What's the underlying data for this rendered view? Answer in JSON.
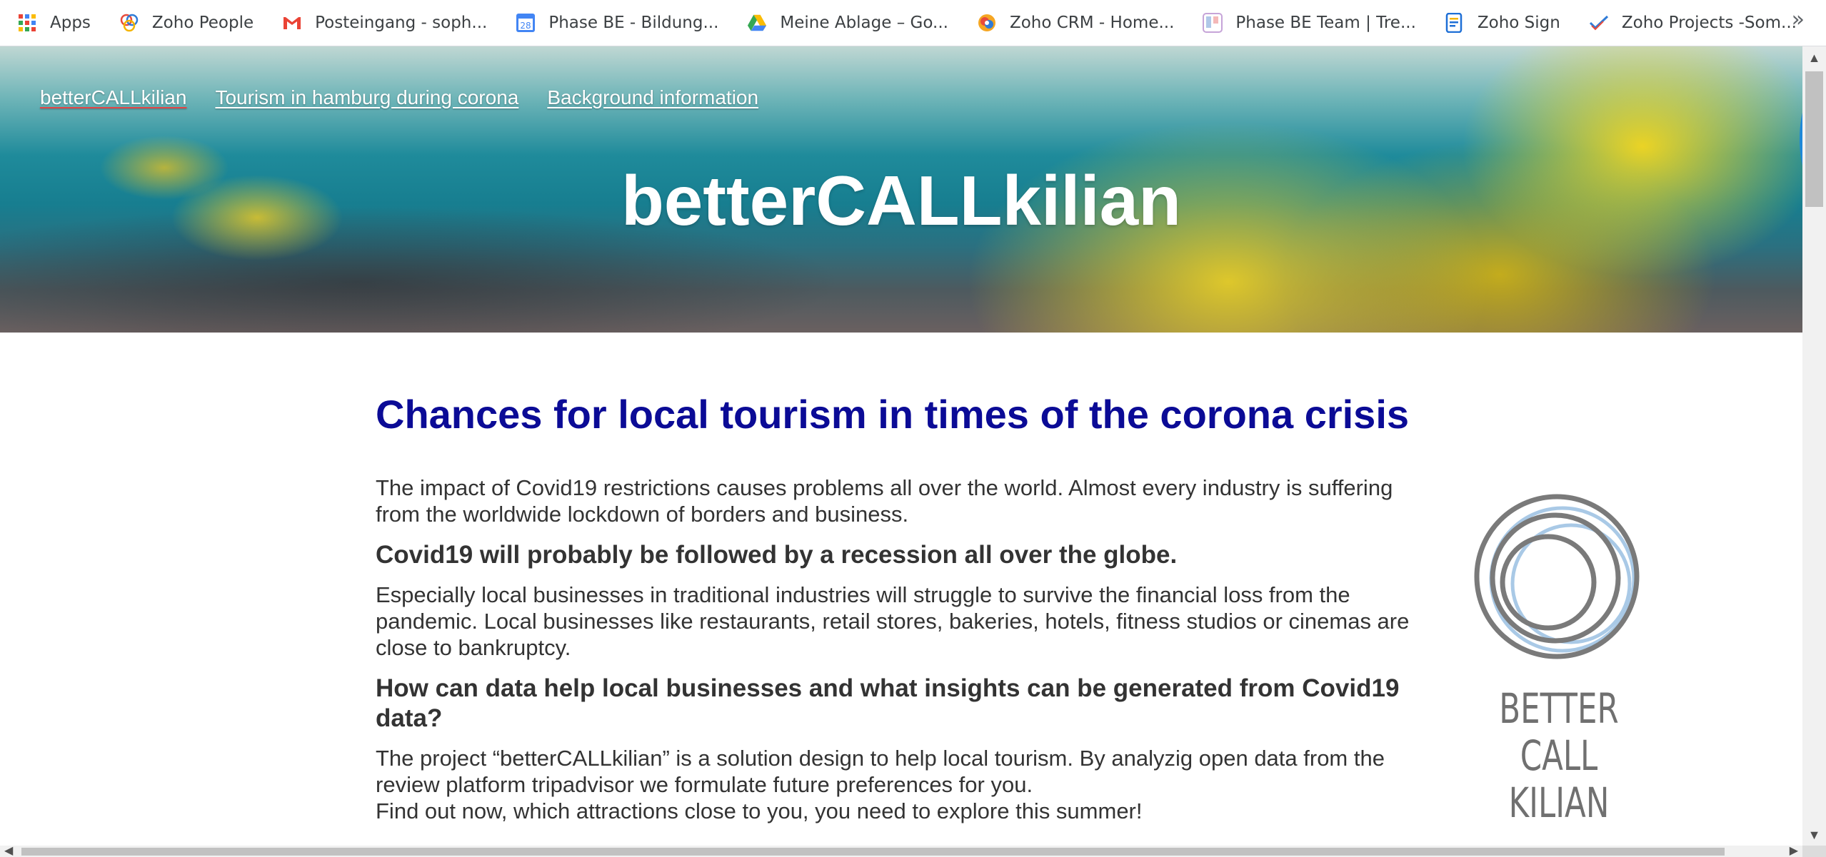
{
  "bookmarks": [
    {
      "label": "Apps",
      "icon": "apps-grid-icon"
    },
    {
      "label": "Zoho People",
      "icon": "zoho-people-icon"
    },
    {
      "label": "Posteingang - soph...",
      "icon": "gmail-icon"
    },
    {
      "label": "Phase BE - Bildung...",
      "icon": "calendar-icon",
      "icon_text": "28"
    },
    {
      "label": "Meine Ablage – Go...",
      "icon": "google-drive-icon"
    },
    {
      "label": "Zoho CRM - Home...",
      "icon": "zoho-crm-icon"
    },
    {
      "label": "Phase BE Team | Tre...",
      "icon": "trello-icon"
    },
    {
      "label": "Zoho Sign",
      "icon": "zoho-sign-icon"
    },
    {
      "label": "Zoho Projects -Som...",
      "icon": "zoho-projects-icon"
    }
  ],
  "bookmarks_more": "»",
  "nav": [
    {
      "label": "betterCALLkilian"
    },
    {
      "label": "Tourism in hamburg during corona"
    },
    {
      "label": "Background information"
    }
  ],
  "hero": {
    "title": "betterCALLkilian"
  },
  "main": {
    "heading": "Chances for local tourism in times of the corona crisis",
    "p1": "The impact of Covid19 restrictions causes problems all over the world. Almost every industry is suffering from the worldwide lockdown of borders and business.",
    "h2a": "Covid19 will probably be followed by a recession all over the globe.",
    "p2": "Especially local businesses in traditional industries will struggle to survive the financial loss from the pandemic. Local businesses like restaurants, retail stores, bakeries, hotels, fitness studios or cinemas are close to bankruptcy.",
    "h2b": "How can data help local businesses and what insights can be generated from Covid19 data?",
    "p3a": "The project “betterCALLkilian” is a solution design to help local tourism. By analyzig open data from the review platform tripadvisor we formulate future preferences for you.",
    "p3b": "Find out now, which attractions close to you, you need to explore this summer!"
  },
  "logo": {
    "line1": "BETTER",
    "line2": "CALL",
    "line3": "KILIAN"
  },
  "colors": {
    "heading": "#0b0b96",
    "body_text": "#333333",
    "logo_dark": "#7a7a7a",
    "logo_light": "#a9c9e6"
  }
}
